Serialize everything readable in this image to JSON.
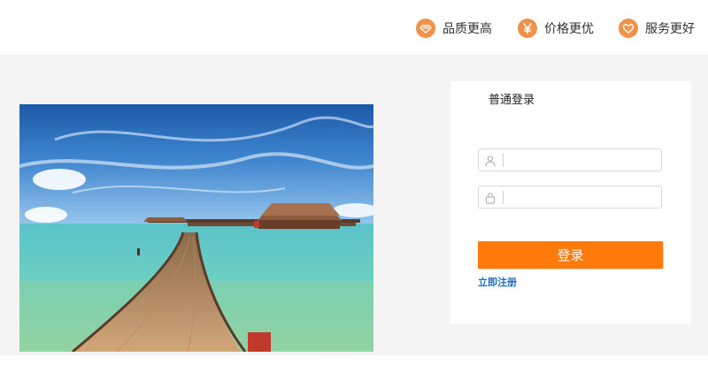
{
  "header": {
    "features": [
      {
        "label": "品质更高",
        "icon": "diamond-icon"
      },
      {
        "label": "价格更优",
        "icon": "yen-icon"
      },
      {
        "label": "服务更好",
        "icon": "heart-icon"
      }
    ],
    "accent_color": "#f0924b"
  },
  "hero": {
    "image": "beach-pier-photo"
  },
  "login": {
    "tab_label": "普通登录",
    "username": {
      "value": "",
      "placeholder": "",
      "icon": "user-icon"
    },
    "password": {
      "value": "",
      "placeholder": "",
      "icon": "lock-icon"
    },
    "submit_label": "登录",
    "register_label": "立即注册",
    "button_color": "#ff7a0a",
    "link_color": "#1f6fbf"
  }
}
